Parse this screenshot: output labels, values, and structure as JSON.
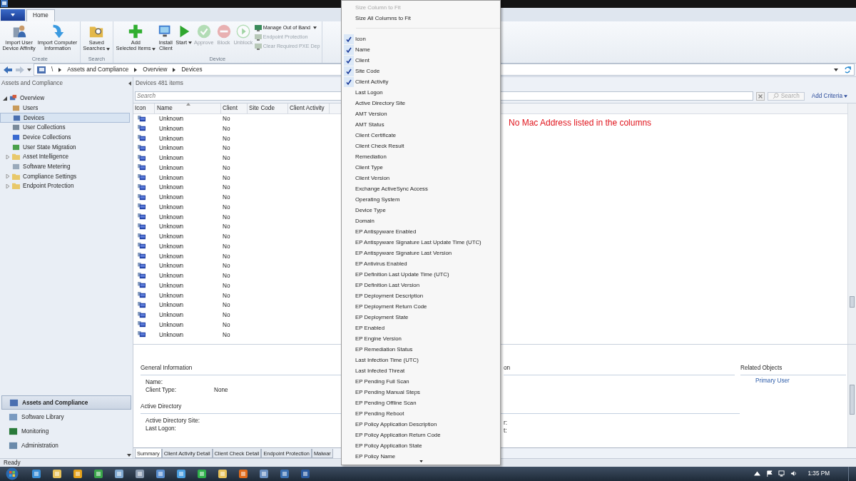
{
  "ribbon": {
    "tabs": [
      {
        "label": "Home",
        "selected": true
      }
    ],
    "groups": [
      {
        "label": "Create",
        "buttons": [
          {
            "label": "Import User\nDevice Affinity",
            "disabled": false,
            "dropdown": false
          },
          {
            "label": "Import Computer\nInformation",
            "disabled": false,
            "dropdown": false
          }
        ]
      },
      {
        "label": "Search",
        "buttons": [
          {
            "label": "Saved\nSearches",
            "disabled": false,
            "dropdown": true
          }
        ]
      },
      {
        "label": "Device",
        "buttons": [
          {
            "label": "Add\nSelected Items",
            "disabled": false,
            "dropdown": true
          },
          {
            "label": "Install\nClient",
            "disabled": false,
            "dropdown": false
          },
          {
            "label": "Start",
            "disabled": false,
            "dropdown": true
          },
          {
            "label": "Approve",
            "disabled": true,
            "dropdown": false
          },
          {
            "label": "Block",
            "disabled": true,
            "dropdown": false
          },
          {
            "label": "Unblock",
            "disabled": true,
            "dropdown": false
          }
        ],
        "small": [
          {
            "label": "Manage Out of Band",
            "disabled": false,
            "dropdown": true
          },
          {
            "label": "Endpoint Protection",
            "disabled": true,
            "dropdown": false
          },
          {
            "label": "Clear Required PXE Dep",
            "disabled": true,
            "dropdown": false
          }
        ]
      }
    ]
  },
  "breadcrumb": {
    "root": "\\",
    "items": [
      "Assets and Compliance",
      "Overview",
      "Devices"
    ]
  },
  "sidebar": {
    "title": "Assets and Compliance",
    "tree": [
      {
        "label": "Overview",
        "expanded": true,
        "selected": false,
        "children": [
          {
            "label": "Users",
            "selected": false
          },
          {
            "label": "Devices",
            "selected": true
          },
          {
            "label": "User Collections",
            "selected": false
          },
          {
            "label": "Device Collections",
            "selected": false
          },
          {
            "label": "User State Migration",
            "selected": false
          },
          {
            "label": "Asset Intelligence",
            "selected": false,
            "expanded": false
          },
          {
            "label": "Software Metering",
            "selected": false
          },
          {
            "label": "Compliance Settings",
            "selected": false,
            "expanded": false
          },
          {
            "label": "Endpoint Protection",
            "selected": false,
            "expanded": false
          }
        ]
      }
    ],
    "workspaces": [
      {
        "label": "Assets and Compliance",
        "selected": true
      },
      {
        "label": "Software Library",
        "selected": false
      },
      {
        "label": "Monitoring",
        "selected": false
      },
      {
        "label": "Administration",
        "selected": false
      }
    ]
  },
  "list": {
    "title": "Devices 481 items",
    "search": {
      "placeholder": "Search",
      "button": "Search",
      "add_criteria": "Add Criteria"
    },
    "columns": [
      "Icon",
      "Name",
      "Client",
      "Site Code",
      "Client Activity"
    ],
    "rows": [
      {
        "name": "Unknown",
        "client": "No"
      },
      {
        "name": "Unknown",
        "client": "No"
      },
      {
        "name": "Unknown",
        "client": "No"
      },
      {
        "name": "Unknown",
        "client": "No"
      },
      {
        "name": "Unknown",
        "client": "No"
      },
      {
        "name": "Unknown",
        "client": "No"
      },
      {
        "name": "Unknown",
        "client": "No"
      },
      {
        "name": "Unknown",
        "client": "No"
      },
      {
        "name": "Unknown",
        "client": "No"
      },
      {
        "name": "Unknown",
        "client": "No"
      },
      {
        "name": "Unknown",
        "client": "No"
      },
      {
        "name": "Unknown",
        "client": "No"
      },
      {
        "name": "Unknown",
        "client": "No"
      },
      {
        "name": "Unknown",
        "client": "No"
      },
      {
        "name": "Unknown",
        "client": "No"
      },
      {
        "name": "Unknown",
        "client": "No"
      },
      {
        "name": "Unknown",
        "client": "No"
      },
      {
        "name": "Unknown",
        "client": "No"
      },
      {
        "name": "Unknown",
        "client": "No"
      },
      {
        "name": "Unknown",
        "client": "No"
      },
      {
        "name": "Unknown",
        "client": "No"
      },
      {
        "name": "Unknown",
        "client": "No"
      },
      {
        "name": "Unknown",
        "client": "No"
      }
    ],
    "annotation": "No Mac Address listed in the columns"
  },
  "details": {
    "general": {
      "heading": "General Information",
      "fields": [
        {
          "label": "Name:"
        },
        {
          "label": "Client Type:",
          "value": "None"
        }
      ]
    },
    "active_directory": {
      "heading": "Active Directory",
      "fields": [
        "Active Directory Site:",
        "Last Logon:"
      ]
    },
    "column_2": {
      "heading": "on",
      "fields": [
        "r:",
        "t:"
      ]
    },
    "related": {
      "heading": "Related Objects",
      "links": [
        "Primary User"
      ]
    },
    "tabs": [
      {
        "label": "Summary",
        "selected": true
      },
      {
        "label": "Client Activity Detail",
        "selected": false
      },
      {
        "label": "Client Check Detail",
        "selected": false
      },
      {
        "label": "Endpoint Protection",
        "selected": false
      },
      {
        "label": "Malwar",
        "selected": false
      }
    ]
  },
  "column_menu": {
    "actions": [
      {
        "label": "Size Column to Fit",
        "disabled": true
      },
      {
        "label": "Size All Columns to Fit",
        "disabled": false
      }
    ],
    "columns": [
      {
        "label": "Icon",
        "checked": true
      },
      {
        "label": "Name",
        "checked": true
      },
      {
        "label": "Client",
        "checked": true
      },
      {
        "label": "Site Code",
        "checked": true
      },
      {
        "label": "Client Activity",
        "checked": true
      },
      {
        "label": "Last Logon",
        "checked": false
      },
      {
        "label": "Active Directory Site",
        "checked": false
      },
      {
        "label": "AMT Version",
        "checked": false
      },
      {
        "label": "AMT Status",
        "checked": false
      },
      {
        "label": "Client Certificate",
        "checked": false
      },
      {
        "label": "Client Check Result",
        "checked": false
      },
      {
        "label": "Remediation",
        "checked": false
      },
      {
        "label": "Client Type",
        "checked": false
      },
      {
        "label": "Client Version",
        "checked": false
      },
      {
        "label": "Exchange ActiveSync Access",
        "checked": false
      },
      {
        "label": "Operating System",
        "checked": false
      },
      {
        "label": "Device Type",
        "checked": false
      },
      {
        "label": "Domain",
        "checked": false
      },
      {
        "label": "EP Antispyware Enabled",
        "checked": false
      },
      {
        "label": "EP Antispyware Signature Last Update Time (UTC)",
        "checked": false
      },
      {
        "label": "EP Antispyware Signature Last Version",
        "checked": false
      },
      {
        "label": "EP Antivirus Enabled",
        "checked": false
      },
      {
        "label": "EP Definition Last Update Time (UTC)",
        "checked": false
      },
      {
        "label": "EP Definition Last Version",
        "checked": false
      },
      {
        "label": "EP Deployment Description",
        "checked": false
      },
      {
        "label": "EP Deployment Return Code",
        "checked": false
      },
      {
        "label": "EP Deployment State",
        "checked": false
      },
      {
        "label": "EP Enabled",
        "checked": false
      },
      {
        "label": "EP Engine Version",
        "checked": false
      },
      {
        "label": "EP Remediation Status",
        "checked": false
      },
      {
        "label": "Last Infection Time (UTC)",
        "checked": false
      },
      {
        "label": "Last Infected Threat",
        "checked": false
      },
      {
        "label": "EP Pending Full Scan",
        "checked": false
      },
      {
        "label": "EP Pending Manual Steps",
        "checked": false
      },
      {
        "label": "EP Pending Offline Scan",
        "checked": false
      },
      {
        "label": "EP Pending Reboot",
        "checked": false
      },
      {
        "label": "EP Policy Application Description",
        "checked": false
      },
      {
        "label": "EP Policy Application Return Code",
        "checked": false
      },
      {
        "label": "EP Policy Application State",
        "checked": false
      },
      {
        "label": "EP Policy Name",
        "checked": false
      }
    ]
  },
  "status_bar": "Ready",
  "taskbar": {
    "clock": "1:35 PM"
  }
}
